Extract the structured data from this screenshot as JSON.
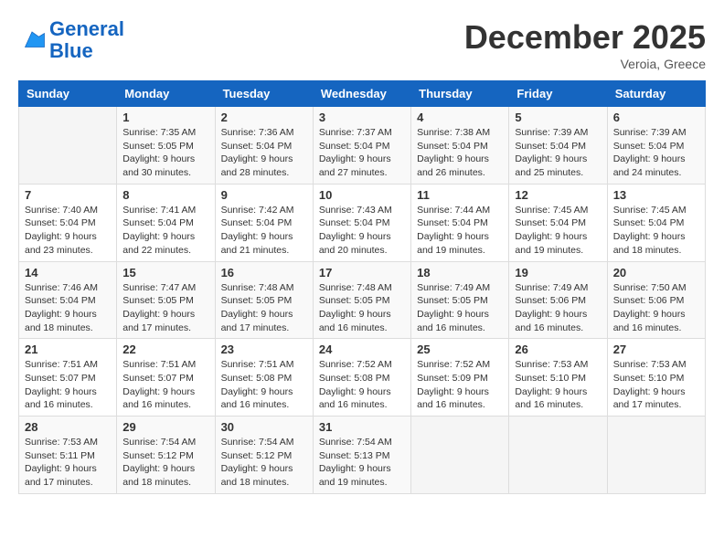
{
  "header": {
    "logo_line1": "General",
    "logo_line2": "Blue",
    "month_year": "December 2025",
    "location": "Veroia, Greece"
  },
  "days_of_week": [
    "Sunday",
    "Monday",
    "Tuesday",
    "Wednesday",
    "Thursday",
    "Friday",
    "Saturday"
  ],
  "weeks": [
    [
      {
        "day": "",
        "info": ""
      },
      {
        "day": "1",
        "sunrise": "7:35 AM",
        "sunset": "5:05 PM",
        "daylight": "9 hours and 30 minutes."
      },
      {
        "day": "2",
        "sunrise": "7:36 AM",
        "sunset": "5:04 PM",
        "daylight": "9 hours and 28 minutes."
      },
      {
        "day": "3",
        "sunrise": "7:37 AM",
        "sunset": "5:04 PM",
        "daylight": "9 hours and 27 minutes."
      },
      {
        "day": "4",
        "sunrise": "7:38 AM",
        "sunset": "5:04 PM",
        "daylight": "9 hours and 26 minutes."
      },
      {
        "day": "5",
        "sunrise": "7:39 AM",
        "sunset": "5:04 PM",
        "daylight": "9 hours and 25 minutes."
      },
      {
        "day": "6",
        "sunrise": "7:39 AM",
        "sunset": "5:04 PM",
        "daylight": "9 hours and 24 minutes."
      }
    ],
    [
      {
        "day": "7",
        "sunrise": "7:40 AM",
        "sunset": "5:04 PM",
        "daylight": "9 hours and 23 minutes."
      },
      {
        "day": "8",
        "sunrise": "7:41 AM",
        "sunset": "5:04 PM",
        "daylight": "9 hours and 22 minutes."
      },
      {
        "day": "9",
        "sunrise": "7:42 AM",
        "sunset": "5:04 PM",
        "daylight": "9 hours and 21 minutes."
      },
      {
        "day": "10",
        "sunrise": "7:43 AM",
        "sunset": "5:04 PM",
        "daylight": "9 hours and 20 minutes."
      },
      {
        "day": "11",
        "sunrise": "7:44 AM",
        "sunset": "5:04 PM",
        "daylight": "9 hours and 19 minutes."
      },
      {
        "day": "12",
        "sunrise": "7:45 AM",
        "sunset": "5:04 PM",
        "daylight": "9 hours and 19 minutes."
      },
      {
        "day": "13",
        "sunrise": "7:45 AM",
        "sunset": "5:04 PM",
        "daylight": "9 hours and 18 minutes."
      }
    ],
    [
      {
        "day": "14",
        "sunrise": "7:46 AM",
        "sunset": "5:04 PM",
        "daylight": "9 hours and 18 minutes."
      },
      {
        "day": "15",
        "sunrise": "7:47 AM",
        "sunset": "5:05 PM",
        "daylight": "9 hours and 17 minutes."
      },
      {
        "day": "16",
        "sunrise": "7:48 AM",
        "sunset": "5:05 PM",
        "daylight": "9 hours and 17 minutes."
      },
      {
        "day": "17",
        "sunrise": "7:48 AM",
        "sunset": "5:05 PM",
        "daylight": "9 hours and 16 minutes."
      },
      {
        "day": "18",
        "sunrise": "7:49 AM",
        "sunset": "5:05 PM",
        "daylight": "9 hours and 16 minutes."
      },
      {
        "day": "19",
        "sunrise": "7:49 AM",
        "sunset": "5:06 PM",
        "daylight": "9 hours and 16 minutes."
      },
      {
        "day": "20",
        "sunrise": "7:50 AM",
        "sunset": "5:06 PM",
        "daylight": "9 hours and 16 minutes."
      }
    ],
    [
      {
        "day": "21",
        "sunrise": "7:51 AM",
        "sunset": "5:07 PM",
        "daylight": "9 hours and 16 minutes."
      },
      {
        "day": "22",
        "sunrise": "7:51 AM",
        "sunset": "5:07 PM",
        "daylight": "9 hours and 16 minutes."
      },
      {
        "day": "23",
        "sunrise": "7:51 AM",
        "sunset": "5:08 PM",
        "daylight": "9 hours and 16 minutes."
      },
      {
        "day": "24",
        "sunrise": "7:52 AM",
        "sunset": "5:08 PM",
        "daylight": "9 hours and 16 minutes."
      },
      {
        "day": "25",
        "sunrise": "7:52 AM",
        "sunset": "5:09 PM",
        "daylight": "9 hours and 16 minutes."
      },
      {
        "day": "26",
        "sunrise": "7:53 AM",
        "sunset": "5:10 PM",
        "daylight": "9 hours and 16 minutes."
      },
      {
        "day": "27",
        "sunrise": "7:53 AM",
        "sunset": "5:10 PM",
        "daylight": "9 hours and 17 minutes."
      }
    ],
    [
      {
        "day": "28",
        "sunrise": "7:53 AM",
        "sunset": "5:11 PM",
        "daylight": "9 hours and 17 minutes."
      },
      {
        "day": "29",
        "sunrise": "7:54 AM",
        "sunset": "5:12 PM",
        "daylight": "9 hours and 18 minutes."
      },
      {
        "day": "30",
        "sunrise": "7:54 AM",
        "sunset": "5:12 PM",
        "daylight": "9 hours and 18 minutes."
      },
      {
        "day": "31",
        "sunrise": "7:54 AM",
        "sunset": "5:13 PM",
        "daylight": "9 hours and 19 minutes."
      },
      {
        "day": "",
        "info": ""
      },
      {
        "day": "",
        "info": ""
      },
      {
        "day": "",
        "info": ""
      }
    ]
  ]
}
